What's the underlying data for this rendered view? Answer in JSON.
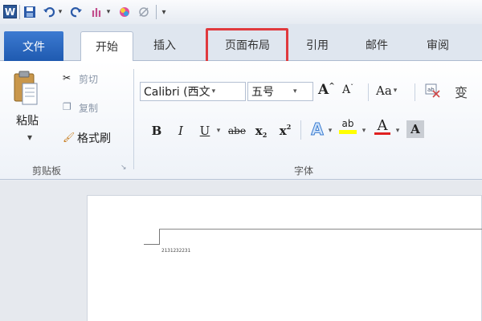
{
  "quick_access": {
    "app_icon_letter": "W",
    "icons": [
      "word-icon",
      "save-icon",
      "undo-icon",
      "redo-icon",
      "paint-icon",
      "color-icon",
      "clear-icon",
      "customize-icon"
    ]
  },
  "tabs": [
    {
      "label": "文件"
    },
    {
      "label": "开始"
    },
    {
      "label": "插入"
    },
    {
      "label": "页面布局"
    },
    {
      "label": "引用"
    },
    {
      "label": "邮件"
    },
    {
      "label": "审阅"
    }
  ],
  "clipboard": {
    "paste_label": "粘贴",
    "cut_label": "剪切",
    "copy_label": "复制",
    "format_painter_label": "格式刷",
    "group_label": "剪贴板"
  },
  "font": {
    "font_name": "Calibri (西文 ",
    "font_size": "五号",
    "grow_label": "A",
    "shrink_label": "A",
    "change_case_label": "Aa",
    "bold": "B",
    "italic": "I",
    "underline": "U",
    "strikethrough": "abe",
    "subscript": "x",
    "superscript": "x",
    "text_effects": "A",
    "highlight": "ab",
    "font_color": "A",
    "char_shading": "A",
    "phonetic": "变",
    "group_label": "字体"
  },
  "document": {
    "text": "2131232231"
  },
  "colors": {
    "file_tab": "#2b6cc4",
    "highlight_box": "#e03a3e",
    "font_color_bar": "#e02020",
    "highlight_color_bar": "#ffff00"
  }
}
